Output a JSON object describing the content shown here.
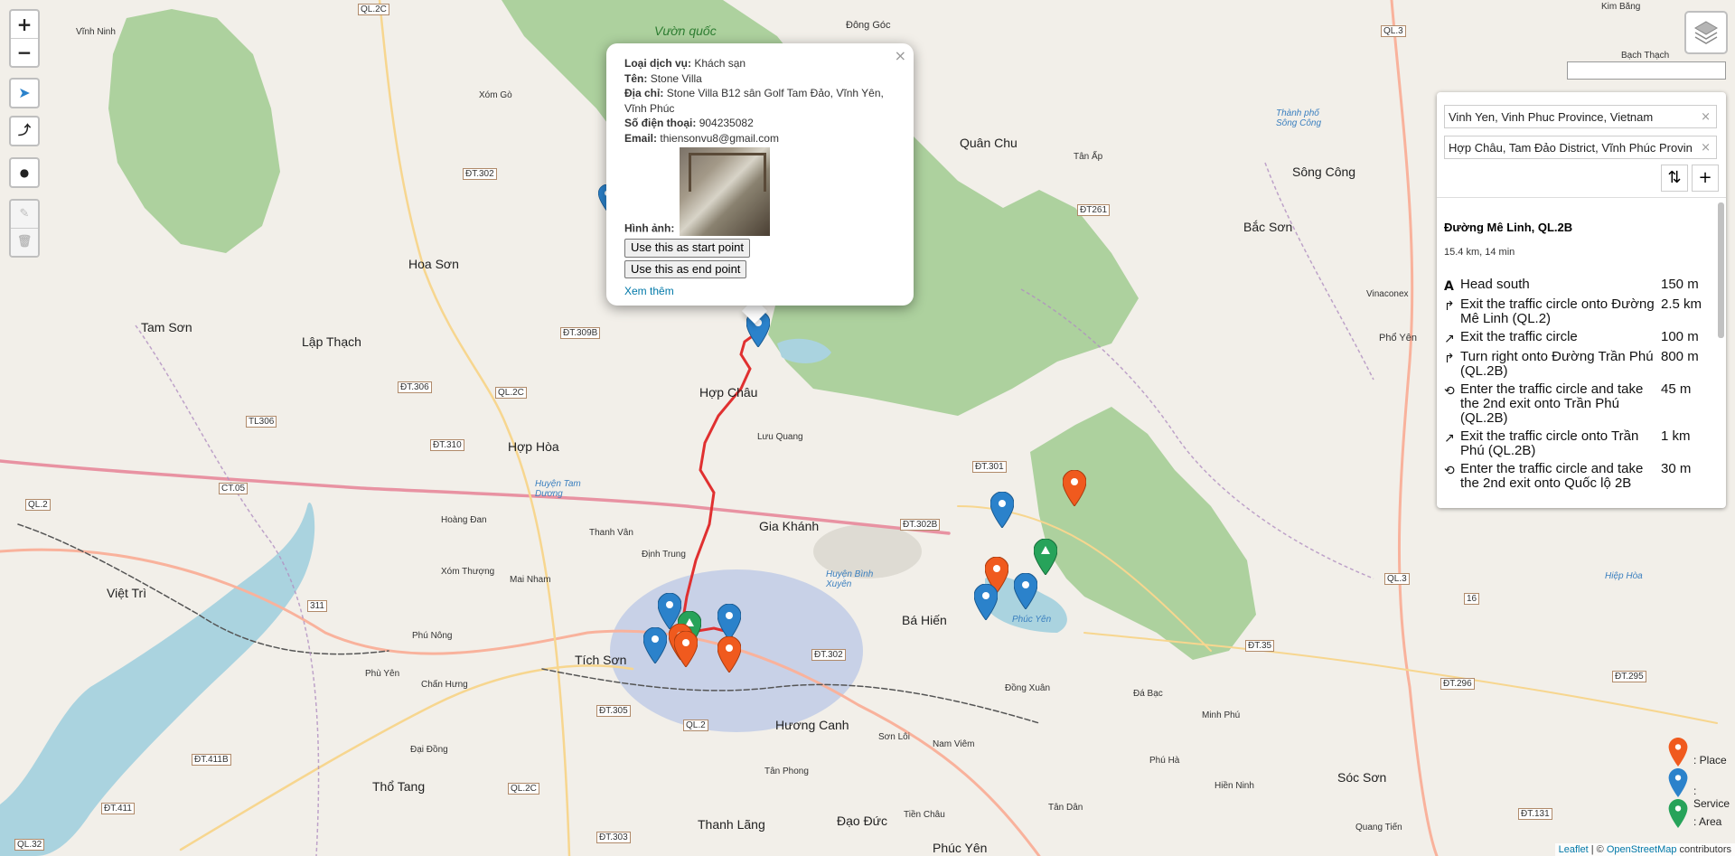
{
  "zoom": {
    "in": "+",
    "out": "−"
  },
  "controls": {
    "locate": "➤",
    "route": "⤴",
    "marker": "●",
    "edit": "✎",
    "delete": "🗑"
  },
  "popup": {
    "close": "×",
    "service_type_label": "Loại dịch vụ:",
    "service_type_value": "Khách sạn",
    "name_label": "Tên:",
    "name_value": "Stone Villa",
    "address_label": "Địa chỉ:",
    "address_value": "Stone Villa B12 sân Golf Tam Đảo, Vĩnh Yên, Vĩnh Phúc",
    "phone_label": "Số điện thoại:",
    "phone_value": "904235082",
    "email_label": "Email:",
    "email_value": "thiensonvu8@gmail.com",
    "image_label": "Hình ảnh:",
    "start_button": "Use this as start point",
    "end_button": "Use this as end point",
    "more_link": "Xem thêm"
  },
  "routing": {
    "start": "Vinh Yen, Vinh Phuc Province, Vietnam",
    "end": "Hợp Châu, Tam Đảo District, Vĩnh Phúc Provin",
    "clear": "×",
    "reverse": "⇅",
    "add": "+",
    "route_name": "Đường Mê Linh, QL.2B",
    "summary": "15.4 km, 14 min",
    "instructions": [
      {
        "icon": "A",
        "text": "Head south",
        "distance": "150 m"
      },
      {
        "icon": "↱",
        "text": "Exit the traffic circle onto Đường Mê Linh (QL.2)",
        "distance": "2.5 km"
      },
      {
        "icon": "↗",
        "text": "Exit the traffic circle",
        "distance": "100 m"
      },
      {
        "icon": "↱",
        "text": "Turn right onto Đường Trần Phú (QL.2B)",
        "distance": "800 m"
      },
      {
        "icon": "⟲",
        "text": "Enter the traffic circle and take the 2nd exit onto Trần Phú (QL.2B)",
        "distance": "45 m"
      },
      {
        "icon": "↗",
        "text": "Exit the traffic circle onto Trần Phú (QL.2B)",
        "distance": "1 km"
      },
      {
        "icon": "⟲",
        "text": "Enter the traffic circle and take the 2nd exit onto Quốc lộ 2B",
        "distance": "30 m"
      }
    ]
  },
  "legend": [
    {
      "label": ": Place",
      "color": "#f05a1e"
    },
    {
      "label": ": Service",
      "color": "#2b82cb"
    },
    {
      "label": ": Area",
      "color": "#27a35a"
    }
  ],
  "attribution": {
    "leaflet": "Leaflet",
    "sep": " | © ",
    "osm": "OpenStreetMap",
    "rest": " contributors"
  },
  "map_labels": {
    "vuon_quoc": "Vườn quốc",
    "dong_goc": "Đông Góc",
    "kim_bang": "Kim Băng",
    "bach_thach": "Bạch Thạch",
    "vinh_ninh": "Vĩnh Ninh",
    "xom_go": "Xóm Gò",
    "quan_chu": "Quân Chu",
    "tan_ap": "Tân Ấp",
    "song_cong": "Sông Công",
    "tp_song_cong": "Thành phố Sông Công",
    "bac_son": "Bắc Sơn",
    "hoa_son": "Hoa Sơn",
    "tam_son": "Tam Sơn",
    "lap_thach": "Lập Thạch",
    "hop_chau": "Hợp Châu",
    "hop_hoa": "Hợp Hòa",
    "luu_quang": "Lưu Quang",
    "gia_khanh": "Gia Khánh",
    "thanh_van": "Thanh Vân",
    "dinh_trung": "Định Trung",
    "xom_thuong": "Xóm Thượng",
    "mai_nham": "Mai Nham",
    "hoang_dan": "Hoàng Đan",
    "viet_tri": "Việt Trì",
    "tich_son": "Tích Sơn",
    "phu_nong": "Phú Nông",
    "phu_yen": "Phù Yên",
    "chan_hung": "Chấn Hưng",
    "ba_hien": "Bá Hiến",
    "huong_canh": "Hương Canh",
    "son_loi": "Sơn Lôi",
    "nam_viem": "Nam Viêm",
    "tan_phong": "Tân Phong",
    "thanh_lang": "Thanh Lãng",
    "dao_duc": "Đạo Đức",
    "phuc_yen": "Phúc Yên",
    "tien_chau": "Tiền Châu",
    "tho_tang": "Thổ Tang",
    "dai_dong": "Đại Đồng",
    "dong_xuan": "Đồng Xuân",
    "da_bac": "Đá Bạc",
    "minh_phu": "Minh Phú",
    "phu_ha": "Phú Hà",
    "hien_ninh": "Hiền Ninh",
    "soc_son": "Sóc Sơn",
    "quang_tien": "Quang Tiến",
    "tan_dan": "Tân Dân",
    "pho_yen": "Phổ Yên",
    "phuc_yen_lake": "Phúc Yên",
    "huyen_binh_xuyen": "Huyện Bình Xuyên",
    "huyen_tam_duong": "Huyện Tam Dương",
    "vinacomex": "Vinaconex",
    "hiep_hoa": "Hiệp Hòa",
    "dt302": "ĐT.302",
    "dt309b": "ĐT.309B",
    "dt306": "ĐT.306",
    "ql2c": "QL.2C",
    "tl306": "TL306",
    "dt310": "ĐT.310",
    "ct05": "CT.05",
    "ql2": "QL.2",
    "dt302b": "ĐT.302B",
    "dt301": "ĐT.301",
    "dt261": "ĐT261",
    "ql3": "QL.3",
    "dt305": "ĐT.305",
    "dt411b": "ĐT.411B",
    "dt411": "ĐT.411",
    "ql32": "QL.32",
    "dt303": "ĐT.303",
    "dt35": "ĐT.35",
    "dt296": "ĐT.296",
    "dt295": "ĐT.295",
    "dt131": "ĐT.131",
    "n311": "311",
    "n16": "16",
    "ql2c_b": "QL.2C",
    "ql2_b": "QL.2",
    "dt302_c": "ĐT.302"
  }
}
